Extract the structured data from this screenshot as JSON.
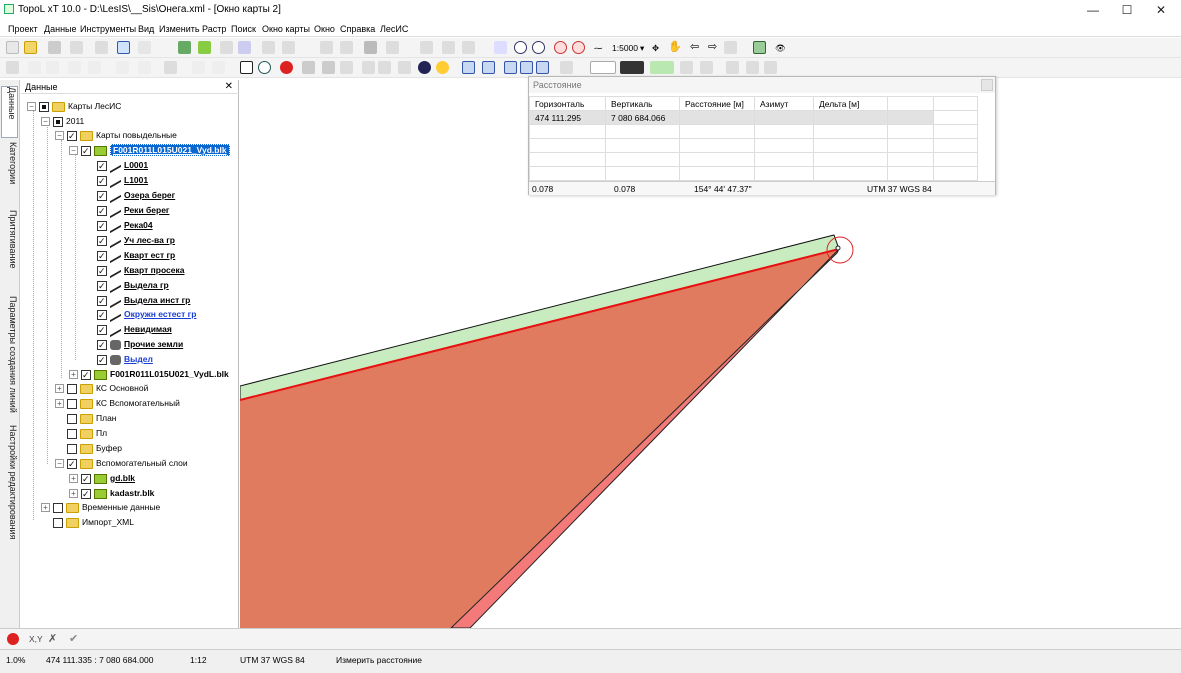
{
  "window": {
    "title": "TopoL xT 10.0 - D:\\LesIS\\__Sis\\Онега.xml - [Окно карты 2]",
    "minimize_icon": "—",
    "maximize_icon": "☐",
    "close_icon": "✕"
  },
  "menu": [
    "Проект",
    "Данные",
    "Инструменты",
    "Вид",
    "Изменить",
    "Растр",
    "Поиск",
    "Окно карты",
    "Окно",
    "Справка",
    "ЛесИС"
  ],
  "toolbar": {
    "scale": "1:5000"
  },
  "side_tabs": [
    "Данные",
    "Категории",
    "Притягивание",
    "Параметры создания линий",
    "Настройки редактирования"
  ],
  "data_panel": {
    "title": "Данные",
    "close": "✕",
    "tree": [
      {
        "label": "Карты ЛесИС"
      },
      {
        "label": "2011"
      },
      {
        "label": "Карты повыдельные"
      },
      {
        "label": "F001R011L015U021_Vyd.blk"
      },
      {
        "label": "L0001"
      },
      {
        "label": "L1001"
      },
      {
        "label": "Озера берег"
      },
      {
        "label": "Реки берег"
      },
      {
        "label": "Река04"
      },
      {
        "label": "Уч лес-ва гр"
      },
      {
        "label": "Кварт ест гр"
      },
      {
        "label": "Кварт просека"
      },
      {
        "label": "Выдела гр"
      },
      {
        "label": "Выдела инст гр"
      },
      {
        "label": "Окружн естест гр"
      },
      {
        "label": "Невидимая"
      },
      {
        "label": "Прочие земли"
      },
      {
        "label": "Выдел"
      },
      {
        "label": "F001R011L015U021_VydL.blk"
      },
      {
        "label": "КС Основной"
      },
      {
        "label": "КС Вспомогательный"
      },
      {
        "label": "План"
      },
      {
        "label": "Пл"
      },
      {
        "label": "Буфер"
      },
      {
        "label": "Вспомогательный слои"
      },
      {
        "label": "gd.blk"
      },
      {
        "label": "kadastr.blk"
      },
      {
        "label": "Временные данные"
      },
      {
        "label": "Импорт_XML"
      }
    ]
  },
  "distance_dialog": {
    "title": "Расстояние",
    "columns": [
      "Горизонталь",
      "Вертикаль",
      "Расстояние [м]",
      "Азимут",
      "Дельта [м]"
    ],
    "rows": [
      [
        "474 111.295",
        "7 080 684.066",
        "",
        "",
        ""
      ]
    ],
    "footer": {
      "a": "0.078",
      "b": "0.078",
      "azimuth": "154° 44' 47.37\"",
      "crs": "UTM 37 WGS 84"
    }
  },
  "editbar": {
    "xy": "X,Y"
  },
  "status": {
    "zoom": "1.0%",
    "coords": "474 111.335 : 7 080 684.000",
    "scale": "1:12",
    "crs": "UTM 37 WGS 84",
    "tool": "Измерить расстояние"
  },
  "colors": {
    "polygon_fill": "#e07b60",
    "green_band": "#c8ecc0",
    "red_band": "#f47a7a",
    "red_edge": "#e81010",
    "selection": "#0a66d0"
  }
}
